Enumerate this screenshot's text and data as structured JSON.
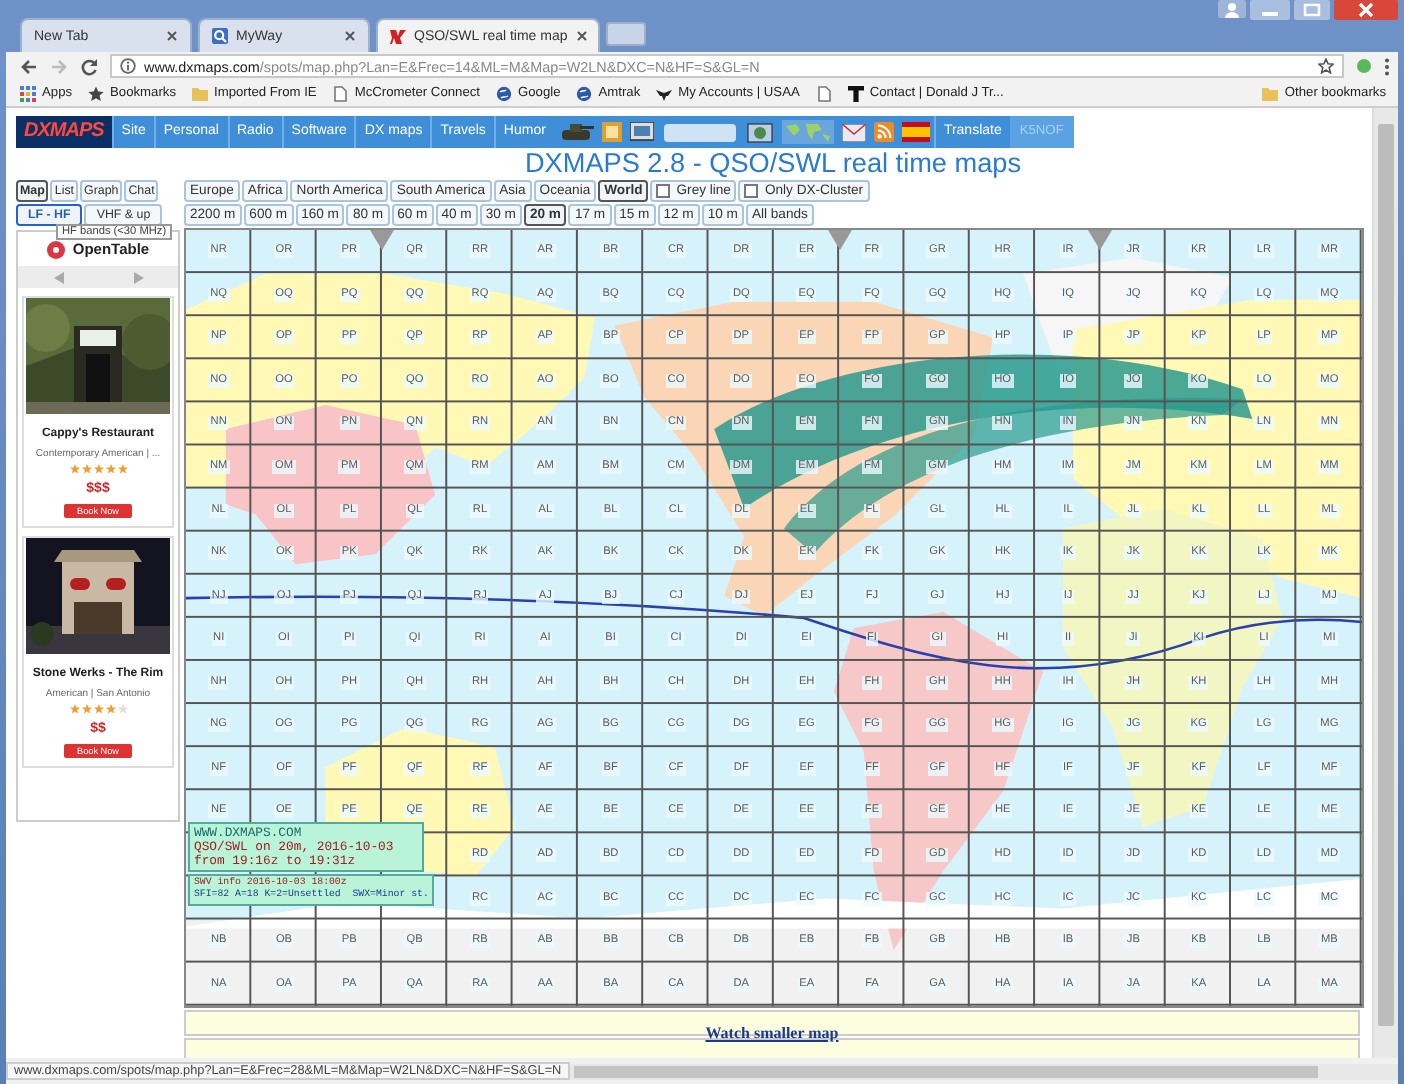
{
  "browser": {
    "tabs": [
      {
        "title": "New Tab",
        "kind": "blank",
        "selected": false
      },
      {
        "title": "MyWay",
        "kind": "myway",
        "selected": false
      },
      {
        "title": "QSO/SWL real time map",
        "kind": "dxmaps",
        "selected": true
      }
    ],
    "url_host": "www.dxmaps.com",
    "url_path": "/spots/map.php?Lan=E&Frec=14&ML=M&Map=W2LN&DXC=N&HF=S&GL=N",
    "bookmarks": [
      {
        "label": "Apps",
        "kind": "apps"
      },
      {
        "label": "Bookmarks",
        "kind": "star"
      },
      {
        "label": "Imported From IE",
        "kind": "folder"
      },
      {
        "label": "McCrometer Connect",
        "kind": "page"
      },
      {
        "label": "Google",
        "kind": "globe"
      },
      {
        "label": "Amtrak",
        "kind": "globe"
      },
      {
        "label": "My Accounts | USAA",
        "kind": "eagle"
      },
      {
        "kind": "page"
      },
      {
        "label": "Contact | Donald J Tr...",
        "kind": "letter"
      }
    ],
    "other_bookmarks": "Other bookmarks"
  },
  "nav": {
    "logo": "DXMAPS",
    "items": [
      "Site",
      "Personal",
      "Radio",
      "Software",
      "DX maps",
      "Travels",
      "Humor"
    ],
    "translate": "Translate",
    "callsign": "K5NOF"
  },
  "title": "DXMAPS 2.8 - QSO/SWL real time maps",
  "view_tabs": [
    {
      "label": "Map",
      "selected": true
    },
    {
      "label": "List",
      "selected": false
    },
    {
      "label": "Graph",
      "selected": false
    },
    {
      "label": "Chat",
      "selected": false
    }
  ],
  "range_tabs": [
    {
      "label": "LF - HF",
      "selected": true
    },
    {
      "label": "VHF & up",
      "selected": false
    }
  ],
  "tooltip": "HF bands (<30 MHz)",
  "regions": [
    {
      "label": "Europe",
      "selected": false
    },
    {
      "label": "Africa",
      "selected": false
    },
    {
      "label": "North America",
      "selected": false
    },
    {
      "label": "South America",
      "selected": false
    },
    {
      "label": "Asia",
      "selected": false
    },
    {
      "label": "Oceania",
      "selected": false
    },
    {
      "label": "World",
      "selected": true
    }
  ],
  "options": [
    {
      "label": "Grey line",
      "checked": false
    },
    {
      "label": "Only DX-Cluster",
      "checked": false
    }
  ],
  "bands": [
    {
      "label": "2200 m",
      "selected": false
    },
    {
      "label": "600 m",
      "selected": false
    },
    {
      "label": "160 m",
      "selected": false
    },
    {
      "label": "80 m",
      "selected": false
    },
    {
      "label": "60 m",
      "selected": false
    },
    {
      "label": "40 m",
      "selected": false
    },
    {
      "label": "30 m",
      "selected": false
    },
    {
      "label": "20 m",
      "selected": true
    },
    {
      "label": "17 m",
      "selected": false
    },
    {
      "label": "15 m",
      "selected": false
    },
    {
      "label": "12 m",
      "selected": false
    },
    {
      "label": "10 m",
      "selected": false
    },
    {
      "label": "All bands",
      "selected": false
    }
  ],
  "ad": {
    "brand": "OpenTable",
    "restaurants": [
      {
        "name": "Cappy's Restaurant",
        "cuisine": "Contemporary American | ...",
        "stars": 5,
        "price": "$$$",
        "button": "Book Now",
        "kind": "picture"
      },
      {
        "name": "Stone Werks - The Rim",
        "cuisine": "American | San Antonio",
        "stars": 4,
        "price": "$$",
        "button": "Book Now",
        "kind": "picture"
      }
    ]
  },
  "map": {
    "grid": [
      [
        "NR",
        "OR",
        "PR",
        "QR",
        "RR",
        "AR",
        "BR",
        "CR",
        "DR",
        "ER",
        "FR",
        "GR",
        "HR",
        "IR",
        "JR",
        "KR",
        "LR",
        "MR"
      ],
      [
        "NQ",
        "OQ",
        "PQ",
        "QQ",
        "RQ",
        "AQ",
        "BQ",
        "CQ",
        "DQ",
        "EQ",
        "FQ",
        "GQ",
        "HQ",
        "IQ",
        "JQ",
        "KQ",
        "LQ",
        "MQ"
      ],
      [
        "NP",
        "OP",
        "PP",
        "QP",
        "RP",
        "AP",
        "BP",
        "CP",
        "DP",
        "EP",
        "FP",
        "GP",
        "HP",
        "IP",
        "JP",
        "KP",
        "LP",
        "MP"
      ],
      [
        "NO",
        "OO",
        "PO",
        "QO",
        "RO",
        "AO",
        "BO",
        "CO",
        "DO",
        "EO",
        "FO",
        "GO",
        "HO",
        "IO",
        "JO",
        "KO",
        "LO",
        "MO"
      ],
      [
        "NN",
        "ON",
        "PN",
        "QN",
        "RN",
        "AN",
        "BN",
        "CN",
        "DN",
        "EN",
        "FN",
        "GN",
        "HN",
        "IN",
        "JN",
        "KN",
        "LN",
        "MN"
      ],
      [
        "NM",
        "OM",
        "PM",
        "QM",
        "RM",
        "AM",
        "BM",
        "CM",
        "DM",
        "EM",
        "FM",
        "GM",
        "HM",
        "IM",
        "JM",
        "KM",
        "LM",
        "MM"
      ],
      [
        "NL",
        "OL",
        "PL",
        "QL",
        "RL",
        "AL",
        "BL",
        "CL",
        "DL",
        "EL",
        "FL",
        "GL",
        "HL",
        "IL",
        "JL",
        "KL",
        "LL",
        "ML"
      ],
      [
        "NK",
        "OK",
        "PK",
        "QK",
        "RK",
        "AK",
        "BK",
        "CK",
        "DK",
        "EK",
        "FK",
        "GK",
        "HK",
        "IK",
        "JK",
        "KK",
        "LK",
        "MK"
      ],
      [
        "NJ",
        "OJ",
        "PJ",
        "QJ",
        "RJ",
        "AJ",
        "BJ",
        "CJ",
        "DJ",
        "EJ",
        "FJ",
        "GJ",
        "HJ",
        "IJ",
        "JJ",
        "KJ",
        "LJ",
        "MJ"
      ],
      [
        "NI",
        "OI",
        "PI",
        "QI",
        "RI",
        "AI",
        "BI",
        "CI",
        "DI",
        "EI",
        "FI",
        "GI",
        "HI",
        "II",
        "JI",
        "KI",
        "LI",
        "MI"
      ],
      [
        "NH",
        "OH",
        "PH",
        "QH",
        "RH",
        "AH",
        "BH",
        "CH",
        "DH",
        "EH",
        "FH",
        "GH",
        "HH",
        "IH",
        "JH",
        "KH",
        "LH",
        "MH"
      ],
      [
        "NG",
        "OG",
        "PG",
        "QG",
        "RG",
        "AG",
        "BG",
        "CG",
        "DG",
        "EG",
        "FG",
        "GG",
        "HG",
        "IG",
        "JG",
        "KG",
        "LG",
        "MG"
      ],
      [
        "NF",
        "OF",
        "PF",
        "QF",
        "RF",
        "AF",
        "BF",
        "CF",
        "DF",
        "EF",
        "FF",
        "GF",
        "HF",
        "IF",
        "JF",
        "KF",
        "LF",
        "MF"
      ],
      [
        "NE",
        "OE",
        "PE",
        "QE",
        "RE",
        "AE",
        "BE",
        "CE",
        "DE",
        "EE",
        "FE",
        "GE",
        "HE",
        "IE",
        "JE",
        "KE",
        "LE",
        "ME"
      ],
      [
        "RD",
        "AD",
        "BD",
        "CD",
        "DD",
        "ED",
        "FD",
        "GD",
        "HD",
        "ID",
        "JD",
        "KD",
        "LD",
        "MD"
      ],
      [
        "RC",
        "AC",
        "BC",
        "CC",
        "DC",
        "EC",
        "FC",
        "GC",
        "HC",
        "IC",
        "JC",
        "KC",
        "LC",
        "MC"
      ],
      [
        "NB",
        "OB",
        "PB",
        "QB",
        "RB",
        "AB",
        "BB",
        "CB",
        "DB",
        "EB",
        "FB",
        "GB",
        "HB",
        "IB",
        "JB",
        "KB",
        "LB",
        "MB"
      ],
      [
        "NA",
        "OA",
        "PA",
        "QA",
        "RA",
        "AA",
        "BA",
        "CA",
        "DA",
        "EA",
        "FA",
        "GA",
        "HA",
        "IA",
        "JA",
        "KA",
        "LA",
        "MA"
      ]
    ],
    "info_lines": [
      "WWW.DXMAPS.COM",
      "QSO/SWL on 20m, 2016-10-03",
      "from 19:16z to 19:31z"
    ],
    "weather_lines": [
      "SWV info 2016-10-03 18:00z",
      "SFI=82 A=18 K=2=Unsettled  SWX=Minor st."
    ]
  },
  "watch_link": "Watch smaller map",
  "status_url": "www.dxmaps.com/spots/map.php?Lan=E&Frec=28&ML=M&Map=W2LN&DXC=N&HF=S&GL=N"
}
